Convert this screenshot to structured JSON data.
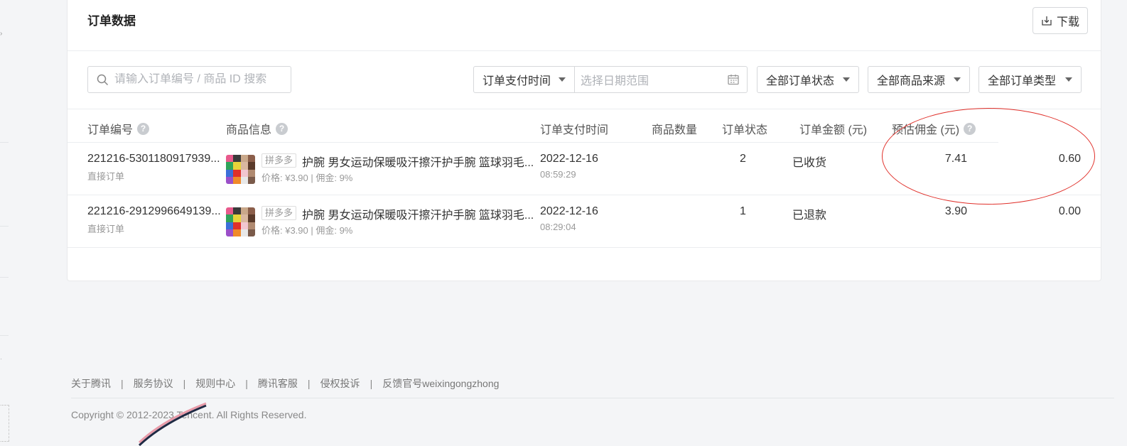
{
  "card": {
    "title": "订单数据",
    "download_label": "下载"
  },
  "filters": {
    "search_placeholder": "请输入订单编号 / 商品 ID 搜索",
    "time_type": "订单支付时间",
    "date_placeholder": "选择日期范围",
    "status": "全部订单状态",
    "source": "全部商品来源",
    "type": "全部订单类型"
  },
  "table": {
    "headers": {
      "order_no": "订单编号",
      "product": "商品信息",
      "pay_time": "订单支付时间",
      "quantity": "商品数量",
      "status": "订单状态",
      "amount": "订单金额 (元)",
      "commission": "预估佣金 (元)"
    },
    "rows": [
      {
        "order_no": "221216-5301180917939...",
        "order_kind": "直接订单",
        "platform_tag": "拼多多",
        "product_title": "护腕 男女运动保暖吸汗擦汗护手腕 篮球羽毛...",
        "product_meta": "价格: ¥3.90 | 佣金: 9%",
        "pay_date": "2022-12-16",
        "pay_clock": "08:59:29",
        "quantity": "2",
        "status": "已收货",
        "amount": "7.41",
        "commission": "0.60"
      },
      {
        "order_no": "221216-2912996649139...",
        "order_kind": "直接订单",
        "platform_tag": "拼多多",
        "product_title": "护腕 男女运动保暖吸汗擦汗护手腕 篮球羽毛...",
        "product_meta": "价格: ¥3.90 | 佣金: 9%",
        "pay_date": "2022-12-16",
        "pay_clock": "08:29:04",
        "quantity": "1",
        "status": "已退款",
        "amount": "3.90",
        "commission": "0.00"
      }
    ]
  },
  "footer": {
    "links": [
      "关于腾讯",
      "服务协议",
      "规则中心",
      "腾讯客服",
      "侵权投诉",
      "反馈官号weixingongzhong"
    ],
    "separator": "|",
    "copyright": "Copyright © 2012-2023 Tencent. All Rights Reserved."
  },
  "icons": {
    "search": "search-icon",
    "calendar": "calendar-icon",
    "download": "download-icon",
    "help": "help-icon"
  },
  "colors": {
    "annotation": "#e0302a"
  }
}
